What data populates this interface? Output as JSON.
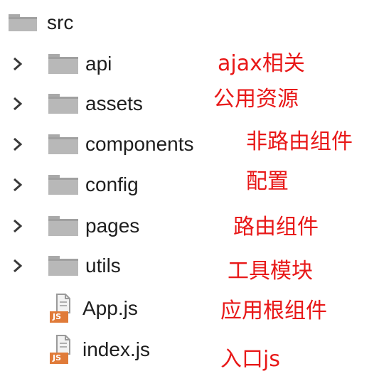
{
  "tree": {
    "root": {
      "label": "src",
      "icon": "folder-icon"
    },
    "items": [
      {
        "label": "api",
        "icon": "folder-icon",
        "note": "ajax相关"
      },
      {
        "label": "assets",
        "icon": "folder-icon",
        "note": "公用资源"
      },
      {
        "label": "components",
        "icon": "folder-icon",
        "note": "非路由组件"
      },
      {
        "label": "config",
        "icon": "folder-icon",
        "note": "配置"
      },
      {
        "label": "pages",
        "icon": "folder-icon",
        "note": "路由组件"
      },
      {
        "label": "utils",
        "icon": "folder-icon",
        "note": "工具模块"
      }
    ],
    "files": [
      {
        "label": "App.js",
        "icon": "js-file-icon",
        "badge": "JS",
        "note": "应用根组件"
      },
      {
        "label": "index.js",
        "icon": "js-file-icon",
        "badge": "JS",
        "note": "入口js"
      }
    ]
  },
  "colors": {
    "folder": "#b8b8b8",
    "folder_dark": "#9a9a9a",
    "annotation": "#e81818",
    "js_badge": "#e07b39",
    "text": "#1e1e1e"
  }
}
